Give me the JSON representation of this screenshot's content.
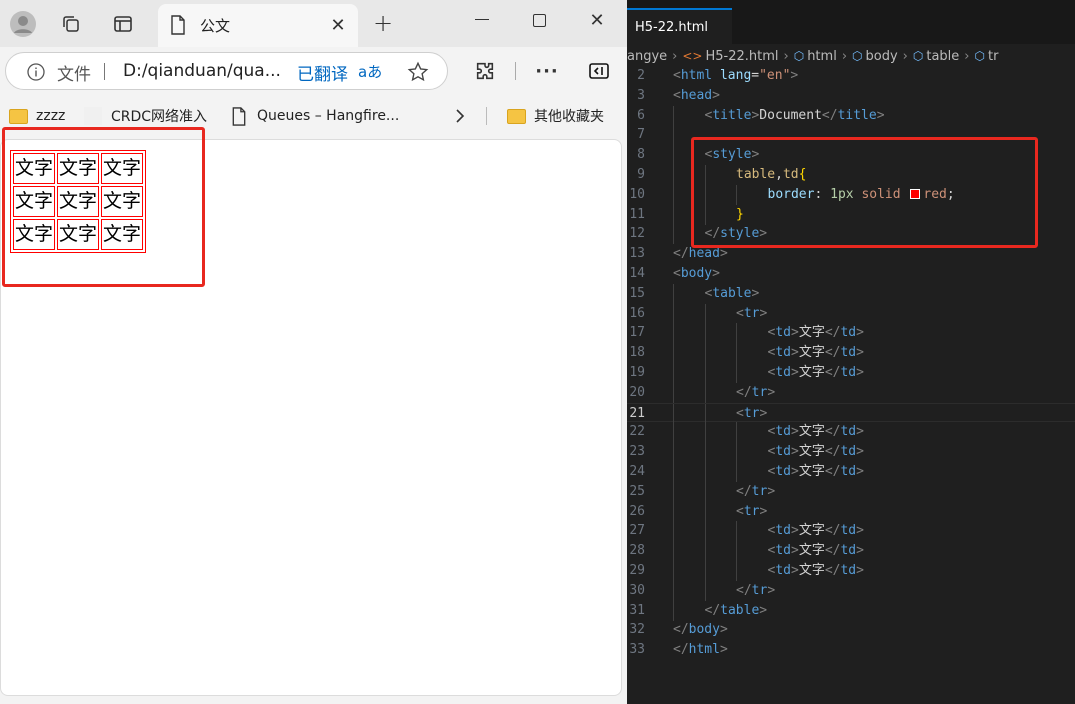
{
  "browser": {
    "tab_title": "公文",
    "address": {
      "info_label": "文件",
      "url": "D:/qianduan/qua...",
      "translated_label": "已翻译",
      "translate_glyph": "aあ"
    },
    "favorites": [
      {
        "label": "zzzz",
        "icon": "folder-icon"
      },
      {
        "label": "CRDC网络准入",
        "icon": "blank-icon"
      },
      {
        "label": "Queues – Hangfire...",
        "icon": "page-icon"
      },
      {
        "label": "其他收藏夹",
        "icon": "folder-icon"
      }
    ],
    "table_rows": [
      [
        "文字",
        "文字",
        "文字"
      ],
      [
        "文字",
        "文字",
        "文字"
      ],
      [
        "文字",
        "文字",
        "文字"
      ]
    ]
  },
  "editor": {
    "tab": "H5-22.html",
    "breadcrumb": [
      "angye",
      "H5-22.html",
      "html",
      "body",
      "table",
      "tr"
    ],
    "active_line": "21",
    "lines": [
      {
        "n": "2",
        "indent": 0,
        "tokens": [
          [
            "br",
            "<"
          ],
          [
            "tg",
            "html"
          ],
          [
            "wt",
            " "
          ],
          [
            "at",
            "lang"
          ],
          [
            "wt",
            "="
          ],
          [
            "st",
            "\"en\""
          ],
          [
            "br",
            ">"
          ]
        ]
      },
      {
        "n": "3",
        "indent": 0,
        "tokens": [
          [
            "br",
            "<"
          ],
          [
            "tg",
            "head"
          ],
          [
            "br",
            ">"
          ]
        ]
      },
      {
        "n": "6",
        "indent": 1,
        "tokens": [
          [
            "br",
            "<"
          ],
          [
            "tg",
            "title"
          ],
          [
            "br",
            ">"
          ],
          [
            "wt",
            "Document"
          ],
          [
            "br",
            "</"
          ],
          [
            "tg",
            "title"
          ],
          [
            "br",
            ">"
          ]
        ]
      },
      {
        "n": "7",
        "indent": 1,
        "tokens": []
      },
      {
        "n": "8",
        "indent": 1,
        "tokens": [
          [
            "br",
            "<"
          ],
          [
            "tg",
            "style"
          ],
          [
            "br",
            ">"
          ]
        ]
      },
      {
        "n": "9",
        "indent": 2,
        "tokens": [
          [
            "sel",
            "table"
          ],
          [
            "wt",
            ","
          ],
          [
            "sel",
            "td"
          ],
          [
            "bk",
            "{"
          ]
        ]
      },
      {
        "n": "10",
        "indent": 3,
        "tokens": [
          [
            "pr",
            "border"
          ],
          [
            "wt",
            ": "
          ],
          [
            "nm",
            "1px"
          ],
          [
            "wt",
            " "
          ],
          [
            "st",
            "solid"
          ],
          [
            "wt",
            " "
          ],
          [
            "sw",
            ""
          ],
          [
            "st",
            "red"
          ],
          [
            "wt",
            ";"
          ]
        ]
      },
      {
        "n": "11",
        "indent": 2,
        "tokens": [
          [
            "bk",
            "}"
          ]
        ]
      },
      {
        "n": "12",
        "indent": 1,
        "tokens": [
          [
            "br",
            "</"
          ],
          [
            "tg",
            "style"
          ],
          [
            "br",
            ">"
          ]
        ]
      },
      {
        "n": "13",
        "indent": 0,
        "tokens": [
          [
            "br",
            "</"
          ],
          [
            "tg",
            "head"
          ],
          [
            "br",
            ">"
          ]
        ]
      },
      {
        "n": "14",
        "indent": 0,
        "tokens": [
          [
            "br",
            "<"
          ],
          [
            "tg",
            "body"
          ],
          [
            "br",
            ">"
          ]
        ]
      },
      {
        "n": "15",
        "indent": 1,
        "tokens": [
          [
            "br",
            "<"
          ],
          [
            "tg",
            "table"
          ],
          [
            "br",
            ">"
          ]
        ]
      },
      {
        "n": "16",
        "indent": 2,
        "tokens": [
          [
            "br",
            "<"
          ],
          [
            "tg",
            "tr"
          ],
          [
            "br",
            ">"
          ]
        ]
      },
      {
        "n": "17",
        "indent": 3,
        "tokens": [
          [
            "br",
            "<"
          ],
          [
            "tg",
            "td"
          ],
          [
            "br",
            ">"
          ],
          [
            "wt",
            "文字"
          ],
          [
            "br",
            "</"
          ],
          [
            "tg",
            "td"
          ],
          [
            "br",
            ">"
          ]
        ]
      },
      {
        "n": "18",
        "indent": 3,
        "tokens": [
          [
            "br",
            "<"
          ],
          [
            "tg",
            "td"
          ],
          [
            "br",
            ">"
          ],
          [
            "wt",
            "文字"
          ],
          [
            "br",
            "</"
          ],
          [
            "tg",
            "td"
          ],
          [
            "br",
            ">"
          ]
        ]
      },
      {
        "n": "19",
        "indent": 3,
        "tokens": [
          [
            "br",
            "<"
          ],
          [
            "tg",
            "td"
          ],
          [
            "br",
            ">"
          ],
          [
            "wt",
            "文字"
          ],
          [
            "br",
            "</"
          ],
          [
            "tg",
            "td"
          ],
          [
            "br",
            ">"
          ]
        ]
      },
      {
        "n": "20",
        "indent": 2,
        "tokens": [
          [
            "br",
            "</"
          ],
          [
            "tg",
            "tr"
          ],
          [
            "br",
            ">"
          ]
        ]
      },
      {
        "n": "21",
        "indent": 2,
        "tokens": [
          [
            "br",
            "<"
          ],
          [
            "tg",
            "tr"
          ],
          [
            "br",
            ">"
          ]
        ]
      },
      {
        "n": "22",
        "indent": 3,
        "tokens": [
          [
            "br",
            "<"
          ],
          [
            "tg",
            "td"
          ],
          [
            "br",
            ">"
          ],
          [
            "wt",
            "文字"
          ],
          [
            "br",
            "</"
          ],
          [
            "tg",
            "td"
          ],
          [
            "br",
            ">"
          ]
        ]
      },
      {
        "n": "23",
        "indent": 3,
        "tokens": [
          [
            "br",
            "<"
          ],
          [
            "tg",
            "td"
          ],
          [
            "br",
            ">"
          ],
          [
            "wt",
            "文字"
          ],
          [
            "br",
            "</"
          ],
          [
            "tg",
            "td"
          ],
          [
            "br",
            ">"
          ]
        ]
      },
      {
        "n": "24",
        "indent": 3,
        "tokens": [
          [
            "br",
            "<"
          ],
          [
            "tg",
            "td"
          ],
          [
            "br",
            ">"
          ],
          [
            "wt",
            "文字"
          ],
          [
            "br",
            "</"
          ],
          [
            "tg",
            "td"
          ],
          [
            "br",
            ">"
          ]
        ]
      },
      {
        "n": "25",
        "indent": 2,
        "tokens": [
          [
            "br",
            "</"
          ],
          [
            "tg",
            "tr"
          ],
          [
            "br",
            ">"
          ]
        ]
      },
      {
        "n": "26",
        "indent": 2,
        "tokens": [
          [
            "br",
            "<"
          ],
          [
            "tg",
            "tr"
          ],
          [
            "br",
            ">"
          ]
        ]
      },
      {
        "n": "27",
        "indent": 3,
        "tokens": [
          [
            "br",
            "<"
          ],
          [
            "tg",
            "td"
          ],
          [
            "br",
            ">"
          ],
          [
            "wt",
            "文字"
          ],
          [
            "br",
            "</"
          ],
          [
            "tg",
            "td"
          ],
          [
            "br",
            ">"
          ]
        ]
      },
      {
        "n": "28",
        "indent": 3,
        "tokens": [
          [
            "br",
            "<"
          ],
          [
            "tg",
            "td"
          ],
          [
            "br",
            ">"
          ],
          [
            "wt",
            "文字"
          ],
          [
            "br",
            "</"
          ],
          [
            "tg",
            "td"
          ],
          [
            "br",
            ">"
          ]
        ]
      },
      {
        "n": "29",
        "indent": 3,
        "tokens": [
          [
            "br",
            "<"
          ],
          [
            "tg",
            "td"
          ],
          [
            "br",
            ">"
          ],
          [
            "wt",
            "文字"
          ],
          [
            "br",
            "</"
          ],
          [
            "tg",
            "td"
          ],
          [
            "br",
            ">"
          ]
        ]
      },
      {
        "n": "30",
        "indent": 2,
        "tokens": [
          [
            "br",
            "</"
          ],
          [
            "tg",
            "tr"
          ],
          [
            "br",
            ">"
          ]
        ]
      },
      {
        "n": "31",
        "indent": 1,
        "tokens": [
          [
            "br",
            "</"
          ],
          [
            "tg",
            "table"
          ],
          [
            "br",
            ">"
          ]
        ]
      },
      {
        "n": "32",
        "indent": 0,
        "tokens": [
          [
            "br",
            "</"
          ],
          [
            "tg",
            "body"
          ],
          [
            "br",
            ">"
          ]
        ]
      },
      {
        "n": "33",
        "indent": 0,
        "tokens": [
          [
            "br",
            "</"
          ],
          [
            "tg",
            "html"
          ],
          [
            "br",
            ">"
          ]
        ]
      }
    ]
  },
  "colors": {
    "highlight_box": "#e8281f",
    "table_border": "red",
    "accent": "#0078d4"
  }
}
